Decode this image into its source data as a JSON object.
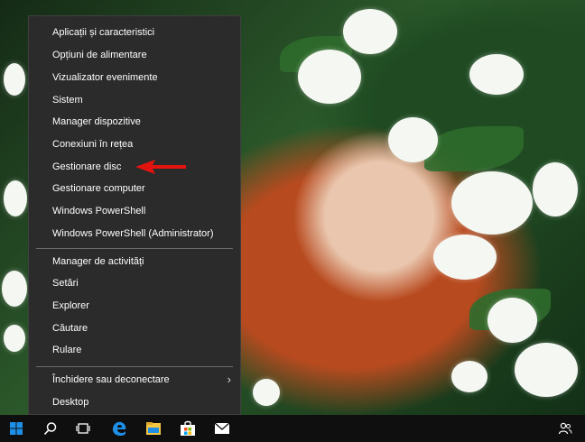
{
  "menu": {
    "items": [
      "Aplicații și caracteristici",
      "Opțiuni de alimentare",
      "Vizualizator evenimente",
      "Sistem",
      "Manager dispozitive",
      "Conexiuni în rețea",
      "Gestionare disc",
      "Gestionare computer",
      "Windows PowerShell",
      "Windows PowerShell (Administrator)",
      "Manager de activități",
      "Setări",
      "Explorer",
      "Căutare",
      "Rulare",
      "Închidere sau deconectare",
      "Desktop"
    ]
  },
  "taskbar": {
    "icons": [
      "windows-start-icon",
      "search-icon",
      "task-view-icon",
      "edge-icon",
      "file-explorer-icon",
      "store-icon",
      "mail-icon",
      "people-icon"
    ]
  },
  "colors": {
    "menu_bg": "#2b2b2b",
    "taskbar_bg": "#0f0f10",
    "edge_blue": "#1e8fe6",
    "arrow_red": "#e3140f"
  }
}
